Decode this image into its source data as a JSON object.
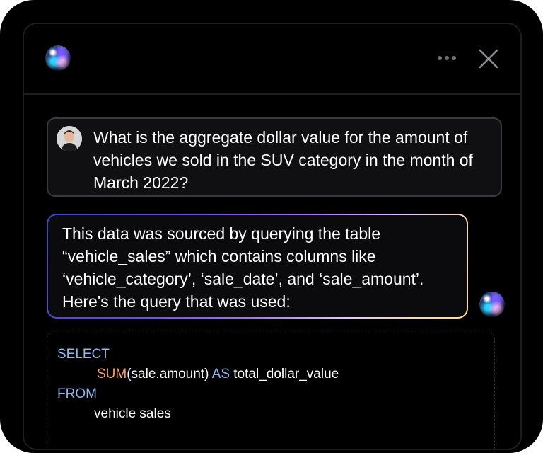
{
  "header": {
    "assistant_icon": "ai-orb-icon",
    "more_icon": "more-horizontal-icon",
    "close_icon": "close-icon"
  },
  "user_message": {
    "avatar": "user-avatar",
    "text": "What is the aggregate dollar value for the amount of vehicles we sold in the SUV category in the month of March 2022?"
  },
  "assistant_message": {
    "line1": "This data was sourced by querying the table",
    "line2": "“vehicle_sales” which contains columns like",
    "line3": "‘vehicle_category’, ‘sale_date’, and ‘sale_amount’.",
    "line4": "Here's the query that was used:"
  },
  "code": {
    "select": "SELECT",
    "sum_fn": "SUM",
    "sum_arg": "(sale.amount) ",
    "as_kw": "AS",
    "alias": " total_dollar_value",
    "from": "FROM",
    "table": "vehicle sales"
  },
  "colors": {
    "background": "#000000",
    "keyword": "#8fb6f0",
    "function": "#f3a16a",
    "gradient_start": "#3c46c8",
    "gradient_end": "#ffe37a"
  }
}
